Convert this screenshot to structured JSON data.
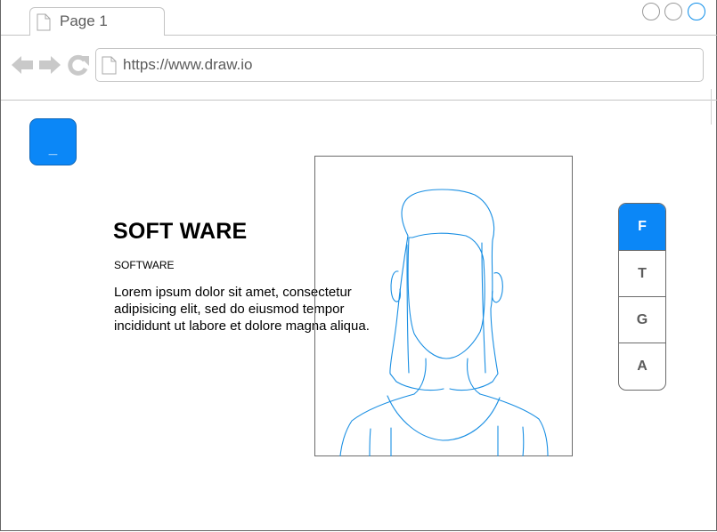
{
  "browser": {
    "tab": {
      "label": "Page 1",
      "icon": "page-icon"
    },
    "window_controls": [
      "minimize-icon",
      "maximize-icon",
      "close-icon"
    ],
    "nav": {
      "icons": [
        "back-arrow-icon",
        "forward-arrow-icon",
        "reload-icon"
      ]
    },
    "address": {
      "value": "https://www.draw.io",
      "icon": "page-icon"
    }
  },
  "content": {
    "menu_button": {
      "label": "_",
      "color": "#0b87f7"
    },
    "headline": "SOFT WARE",
    "subhead": "SOFTWARE",
    "body": "Lorem ipsum dolor sit amet, consectetur adipisicing elit, sed do eiusmod tempor incididunt ut labore et dolore magna aliqua.",
    "portrait": {
      "icon": "person-portrait-icon",
      "line_color": "#1a8fe3"
    }
  },
  "social": {
    "buttons": [
      {
        "label": "F",
        "active": true
      },
      {
        "label": "T",
        "active": false
      },
      {
        "label": "G",
        "active": false
      },
      {
        "label": "A",
        "active": false
      }
    ],
    "active_color": "#0b87f7"
  }
}
